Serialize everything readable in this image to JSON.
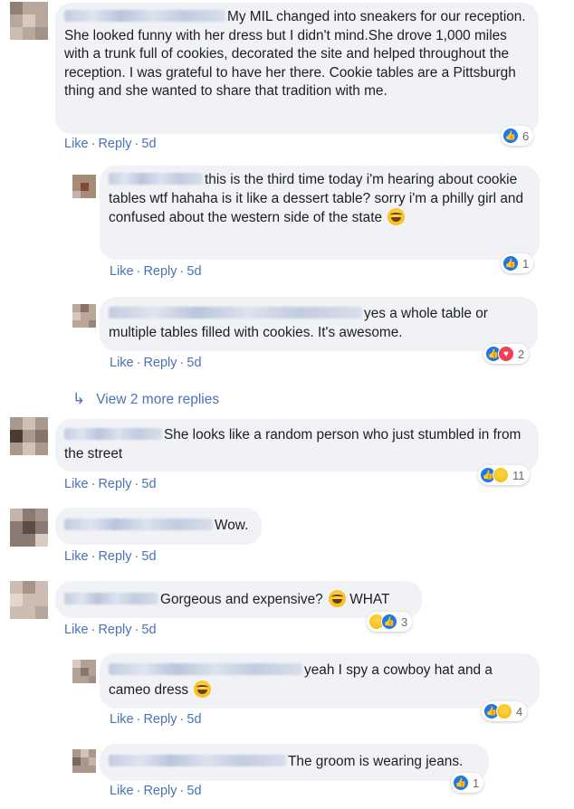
{
  "comments": [
    {
      "text": "My MIL changed into sneakers for our reception. She looked funny with her dress but I didn't mind.She drove 1,000 miles with a trunk full of cookies, decorated the site and helped throughout the reception. I was grateful to have her there. Cookie tables are a Pittsburgh thing and she wanted to share that tradition with me.",
      "like": "Like",
      "reply": "Reply",
      "time": "5d",
      "reaction_count": "6",
      "reaction_icons": [
        "like-icon"
      ]
    },
    {
      "text": "this is the third time today i'm hearing about cookie tables wtf hahaha is it like a dessert table? sorry i'm a philly girl and confused about the western side of the state",
      "like": "Like",
      "reply": "Reply",
      "time": "5d",
      "reaction_count": "1",
      "reaction_icons": [
        "like-icon"
      ]
    },
    {
      "text": "yes a whole table or multiple tables filled with cookies. It's awesome.",
      "like": "Like",
      "reply": "Reply",
      "time": "5d",
      "reaction_count": "2",
      "reaction_icons": [
        "like-icon",
        "love-icon"
      ]
    },
    {
      "text": "She looks like a random person who just stumbled in from the street",
      "like": "Like",
      "reply": "Reply",
      "time": "5d",
      "reaction_count": "11",
      "reaction_icons": [
        "like-icon",
        "haha-icon"
      ]
    },
    {
      "text": "Wow.",
      "like": "Like",
      "reply": "Reply",
      "time": "5d"
    },
    {
      "text": "Gorgeous and expensive?",
      "text_suffix": "WHAT",
      "like": "Like",
      "reply": "Reply",
      "time": "5d",
      "reaction_count": "3",
      "reaction_icons": [
        "haha-icon",
        "like-icon"
      ]
    },
    {
      "text": "yeah I spy a cowboy hat and a cameo dress",
      "like": "Like",
      "reply": "Reply",
      "time": "5d",
      "reaction_count": "4",
      "reaction_icons": [
        "like-icon",
        "haha-icon"
      ]
    },
    {
      "text": "The groom is wearing jeans.",
      "like": "Like",
      "reply": "Reply",
      "time": "5d",
      "reaction_count": "1",
      "reaction_icons": [
        "like-icon"
      ]
    }
  ],
  "view_more_replies": "View 2 more replies",
  "colors": {
    "bubble": "#f0f2f5",
    "link": "#4b71b8",
    "meta": "#65676b",
    "like": "#1877f2",
    "love": "#f33e58",
    "haha": "#f7b500"
  }
}
